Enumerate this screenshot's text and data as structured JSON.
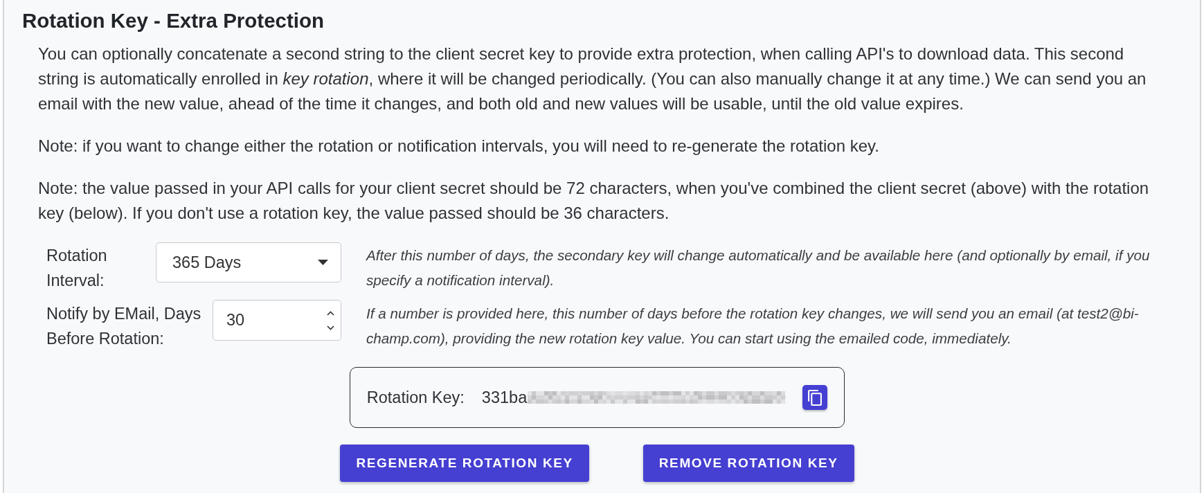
{
  "section": {
    "title": "Rotation Key - Extra Protection"
  },
  "paragraphs": [
    "You can optionally concatenate a second string to the client secret key to provide extra protection, when calling API's to download data. This second string is automatically enrolled in *key rotation*, where it will be changed periodically. (You can also manually change it at any time.) We can send you an email with the new value, ahead of the time it changes, and both old and new values will be usable, until the old value expires.",
    "Note: if you want to change either the rotation or notification intervals, you will need to re-generate the rotation key.",
    "Note: the value passed in your API calls for your client secret should be 72 characters, when you've combined the client secret (above) with the rotation key (below). If you don't use a rotation key, the value passed should be 36 characters."
  ],
  "fields": [
    {
      "kind": "select",
      "label": "Rotation Interval:",
      "value": "365 Days",
      "hint": "After this number of days, the secondary key will change automatically and be available here (and optionally by email, if you specify a notification interval)."
    },
    {
      "kind": "number",
      "label": "Notify by EMail, Days Before Rotation:",
      "value": "30",
      "hint": "If a number is provided here, this number of days before the rotation key changes, we will send you an email (at test2@bi-champ.com), providing the new rotation key value. You can start using the emailed code, immediately."
    }
  ],
  "rotation_key": {
    "label": "Rotation Key:",
    "value": "331ba",
    "redacted": true
  },
  "buttons": [
    {
      "label": "REGENERATE ROTATION KEY"
    },
    {
      "label": "REMOVE ROTATION KEY"
    }
  ]
}
